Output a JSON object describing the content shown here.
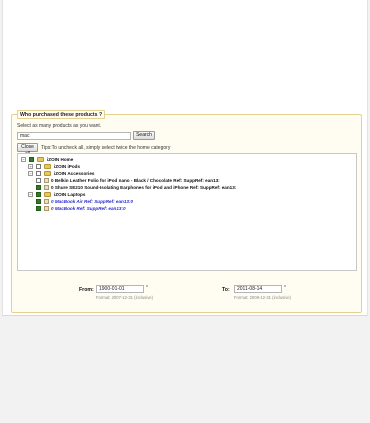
{
  "panel": {
    "legend": "Who purchased these products ?",
    "instructions": "Select as many products as you want.",
    "search": {
      "value": "mac",
      "button_label": "Search"
    },
    "close_all_label": "Close all",
    "tips": "Tips:To uncheck all, simply select twice the home category"
  },
  "tree": {
    "rows": [
      {
        "label": "iZOIN Home"
      },
      {
        "label": "iZOIN iPods"
      },
      {
        "label": "iZOIN Accessories"
      },
      {
        "label": "0 Belkin Leather Folio for iPod nano - Black / Chocolate Ref: SuppRef: ean13:"
      },
      {
        "label": "0 Shure SE210 Sound-Isolating Earphones for iPod and iPhone Ref: SuppRef: ean13:"
      },
      {
        "label": "iZOIN Laptops"
      },
      {
        "label": "0 MacBook Air Ref: SuppRef: ean13:0"
      },
      {
        "label": "0 MacBook Ref: SuppRef: ean13:0"
      }
    ]
  },
  "dates": {
    "from_label": "From:",
    "from_value": "1900-01-01",
    "from_hint": "Format: 2007-12-31 (inclusive)",
    "to_label": "To:",
    "to_value": "2011-08-14",
    "to_hint": "Format: 2008-12-31 (inclusive)",
    "required_mark": "*"
  }
}
